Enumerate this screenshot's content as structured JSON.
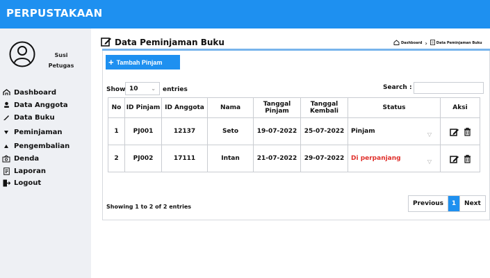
{
  "app": {
    "title": "PERPUSTAKAAN"
  },
  "user": {
    "name": "Susi",
    "role": "Petugas"
  },
  "sidebar": {
    "items": [
      {
        "label": "Dashboard",
        "icon": "home-icon"
      },
      {
        "label": "Data Anggota",
        "icon": "person-icon"
      },
      {
        "label": "Data Buku",
        "icon": "pencil-icon"
      },
      {
        "label": "Peminjaman",
        "icon": "caret-down-icon"
      },
      {
        "label": "Pengembalian",
        "icon": "caret-up-icon"
      },
      {
        "label": "Denda",
        "icon": "cash-icon"
      },
      {
        "label": "Laporan",
        "icon": "report-icon"
      },
      {
        "label": "Logout",
        "icon": "logout-icon"
      }
    ]
  },
  "page": {
    "title": "Data Peminjaman Buku"
  },
  "breadcrumb": {
    "home": "Dashboard",
    "current": "Data Peminjaman Buku"
  },
  "toolbar": {
    "add_label": "Tambah Pinjam"
  },
  "table_controls": {
    "show_label": "Show",
    "entries_value": "10",
    "entries_label": "entries",
    "search_label": "Search :",
    "search_value": ""
  },
  "table": {
    "columns": [
      "No",
      "ID Pinjam",
      "ID Anggota",
      "Nama",
      "Tanggal Pinjam",
      "Tanggal Kembali",
      "Status",
      "Aksi"
    ],
    "rows": [
      {
        "no": "1",
        "id_pinjam": "PJ001",
        "id_anggota": "12137",
        "nama": "Seto",
        "tgl_pinjam": "19-07-2022",
        "tgl_kembali": "25-07-2022",
        "status": "Pinjam"
      },
      {
        "no": "2",
        "id_pinjam": "PJ002",
        "id_anggota": "17111",
        "nama": "Intan",
        "tgl_pinjam": "21-07-2022",
        "tgl_kembali": "29-07-2022",
        "status": "Di perpanjang"
      }
    ]
  },
  "footer": {
    "info": "Showing 1 to 2 of 2 entries",
    "previous": "Previous",
    "page": "1",
    "next": "Next"
  },
  "colors": {
    "accent": "#1e90f0",
    "sidebar_bg": "#eef0f4",
    "status_extended": "#e0302b"
  }
}
